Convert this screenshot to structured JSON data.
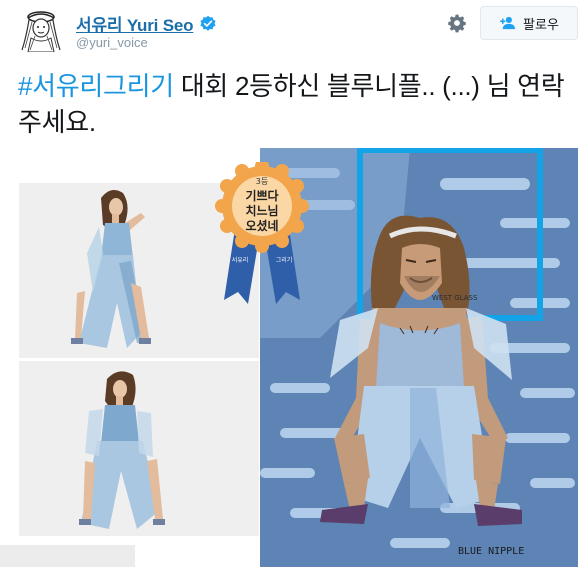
{
  "header": {
    "display_name": "서유리 Yuri Seo",
    "handle": "@yuri_voice",
    "follow_label": "팔로우",
    "verified": true
  },
  "tweet": {
    "hashtag": "#서유리그리기",
    "text_after_hashtag": " 대회 2등하신 블루니플.. (...) 님 연락주세요."
  },
  "media": {
    "badge_lines": [
      "3등",
      "기쁘다",
      "치느님",
      "오셨네"
    ],
    "ribbon_text_left": "서유리",
    "ribbon_text_right": "그리기",
    "signature": "BLUE NIPPLE",
    "shirt_text": "WEST GLASS"
  },
  "icons": {
    "gear": "gear-icon",
    "follow": "add-user-icon",
    "verified": "verified-badge-icon",
    "avatar": "avatar"
  },
  "colors": {
    "name": "#1b6fa8",
    "hashtag": "#1b95e0",
    "handle": "#8899a6",
    "drawing_bg": "#5d84b4",
    "badge_orange": "#f2a54a",
    "ribbon_blue": "#2f5fa8"
  }
}
